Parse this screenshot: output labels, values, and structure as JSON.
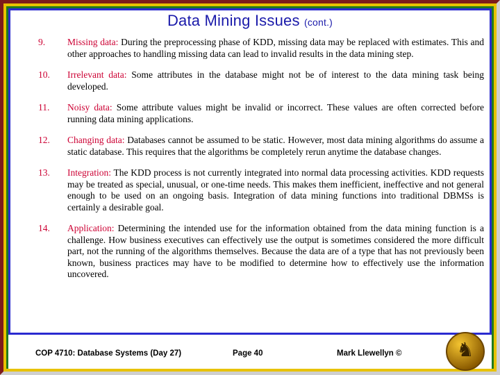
{
  "slide": {
    "title_main": "Data Mining Issues",
    "title_cont": "(cont.)",
    "items": [
      {
        "num": "9.",
        "lead": "Missing data:",
        "text": " During the preprocessing phase of KDD, missing data may be replaced with estimates.  This and other approaches to handling missing data can lead to invalid results in the data mining step."
      },
      {
        "num": "10.",
        "lead": "Irrelevant data:",
        "text": " Some attributes in the database might not be of interest to the data mining task being developed."
      },
      {
        "num": "11.",
        "lead": "Noisy data:",
        "text": "  Some attribute values might be invalid or incorrect.  These values are often corrected before running data mining applications."
      },
      {
        "num": "12.",
        "lead": "Changing data:",
        "text": "  Databases cannot be assumed to be static.  However, most data mining algorithms do assume a static database.  This requires that the algorithms be completely rerun anytime the database changes."
      },
      {
        "num": "13.",
        "lead": "Integration:",
        "text": " The KDD process is not currently integrated into normal data processing activities.  KDD requests may be treated as special, unusual, or one-time needs.  This makes them inefficient, ineffective and not general enough to be used on an ongoing basis.  Integration of data mining functions into traditional DBMSs is certainly a desirable goal."
      },
      {
        "num": "14.",
        "lead": "Application:",
        "text": " Determining the intended use for the information obtained from the data mining function is a challenge.  How business executives can effectively use the output is sometimes considered the more difficult part, not the running of the algorithms themselves. Because the data are of a type that has not previously been known, business practices may have to be modified to determine how to effectively use the information uncovered."
      }
    ]
  },
  "footer": {
    "course": "COP 4710: Database Systems  (Day 27)",
    "page": "Page 40",
    "author": "Mark Llewellyn ©"
  },
  "colors": {
    "title": "#1a1aaa",
    "number": "#cc0033",
    "lead": "#cc0033",
    "body": "#000000",
    "frame_blue": "#2a2ad0",
    "frame_gold": "#e8c200",
    "frame_green": "#1f7a1f",
    "frame_maroon": "#7d1b1b"
  }
}
